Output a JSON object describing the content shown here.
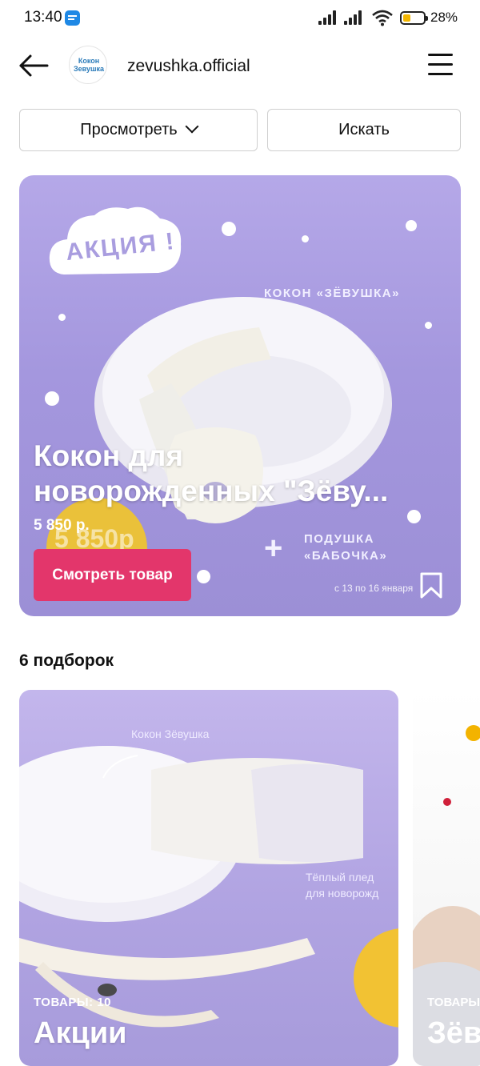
{
  "status_bar": {
    "time": "13:40",
    "battery": "28%"
  },
  "header": {
    "account_name": "zevushka.official",
    "avatar_logo": "Кокон Зевушка"
  },
  "actions": {
    "view_label": "Просмотреть",
    "search_label": "Искать"
  },
  "featured": {
    "promo_badge": "АКЦИЯ !",
    "promo_brand": "КОКОН «ЗЁВУШКА»",
    "pillow_label_1": "ПОДУШКА",
    "pillow_label_2": "«БАБОЧКА»",
    "plus": "+",
    "badge_price": "5 850р",
    "date": "с 13 по 16 января",
    "title": "Кокон для новорожденных \"Зёву...",
    "price": "5 850 р.",
    "cta_label": "Смотреть товар"
  },
  "collections": {
    "heading": "6 подборок",
    "items": [
      {
        "count": "ТОВАРЫ: 10",
        "title": "Акции",
        "caption_1": "Кокон Зёвушка",
        "caption_2": "Тёплый плед",
        "caption_3": "для новорожд"
      },
      {
        "count": "ТОВАРЫ",
        "title": "Зёв"
      }
    ]
  },
  "colors": {
    "accent": "#e3366b",
    "card_purple": "#a497de",
    "price_badge": "#eac13a"
  }
}
